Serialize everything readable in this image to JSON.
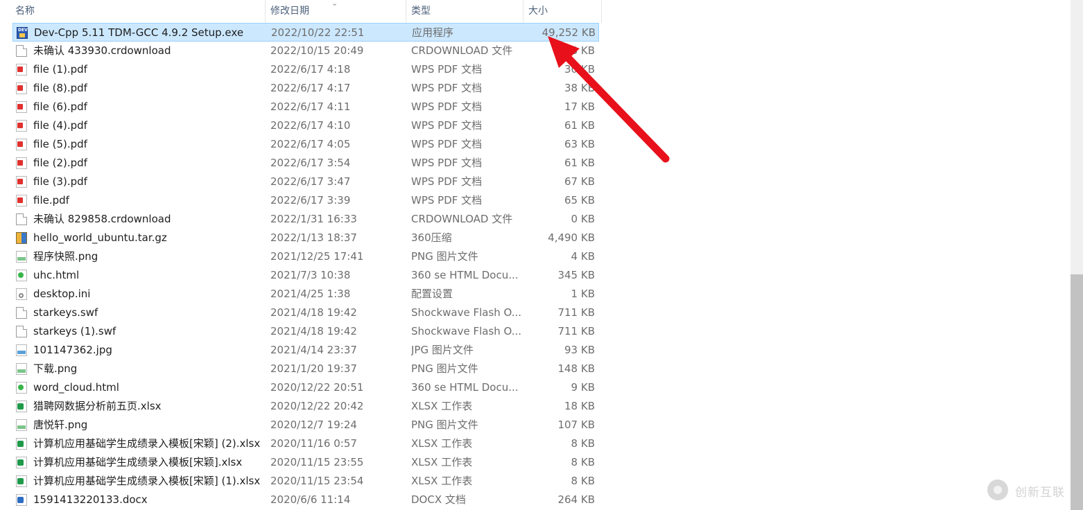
{
  "columns": {
    "name": "名称",
    "modified": "修改日期",
    "type": "类型",
    "size": "大小"
  },
  "files": [
    {
      "name": "Dev-Cpp 5.11 TDM-GCC 4.9.2 Setup.exe",
      "date": "2022/10/22 22:51",
      "type": "应用程序",
      "size": "49,252 KB",
      "icon": "exe-icon",
      "selected": true
    },
    {
      "name": "未确认 433930.crdownload",
      "date": "2022/10/15 20:49",
      "type": "CRDOWNLOAD 文件",
      "size": "3,18 KB",
      "icon": "file-icon"
    },
    {
      "name": "file (1).pdf",
      "date": "2022/6/17 4:18",
      "type": "WPS PDF 文档",
      "size": "30 KB",
      "icon": "pdf-icon"
    },
    {
      "name": "file (8).pdf",
      "date": "2022/6/17 4:17",
      "type": "WPS PDF 文档",
      "size": "38 KB",
      "icon": "pdf-icon"
    },
    {
      "name": "file (6).pdf",
      "date": "2022/6/17 4:11",
      "type": "WPS PDF 文档",
      "size": "17 KB",
      "icon": "pdf-icon"
    },
    {
      "name": "file (4).pdf",
      "date": "2022/6/17 4:10",
      "type": "WPS PDF 文档",
      "size": "61 KB",
      "icon": "pdf-icon"
    },
    {
      "name": "file (5).pdf",
      "date": "2022/6/17 4:05",
      "type": "WPS PDF 文档",
      "size": "63 KB",
      "icon": "pdf-icon"
    },
    {
      "name": "file (2).pdf",
      "date": "2022/6/17 3:54",
      "type": "WPS PDF 文档",
      "size": "61 KB",
      "icon": "pdf-icon"
    },
    {
      "name": "file (3).pdf",
      "date": "2022/6/17 3:47",
      "type": "WPS PDF 文档",
      "size": "67 KB",
      "icon": "pdf-icon"
    },
    {
      "name": "file.pdf",
      "date": "2022/6/17 3:39",
      "type": "WPS PDF 文档",
      "size": "65 KB",
      "icon": "pdf-icon"
    },
    {
      "name": "未确认 829858.crdownload",
      "date": "2022/1/31 16:33",
      "type": "CRDOWNLOAD 文件",
      "size": "0 KB",
      "icon": "file-icon"
    },
    {
      "name": "hello_world_ubuntu.tar.gz",
      "date": "2022/1/13 18:37",
      "type": "360压缩",
      "size": "4,490 KB",
      "icon": "archive-icon"
    },
    {
      "name": "程序快照.png",
      "date": "2021/12/25 17:41",
      "type": "PNG 图片文件",
      "size": "4 KB",
      "icon": "png-icon"
    },
    {
      "name": "uhc.html",
      "date": "2021/7/3 10:38",
      "type": "360 se HTML Docu...",
      "size": "345 KB",
      "icon": "html-icon"
    },
    {
      "name": "desktop.ini",
      "date": "2021/4/25 1:38",
      "type": "配置设置",
      "size": "1 KB",
      "icon": "ini-icon"
    },
    {
      "name": "starkeys.swf",
      "date": "2021/4/18 19:42",
      "type": "Shockwave Flash O...",
      "size": "711 KB",
      "icon": "file-icon"
    },
    {
      "name": "starkeys (1).swf",
      "date": "2021/4/18 19:42",
      "type": "Shockwave Flash O...",
      "size": "711 KB",
      "icon": "file-icon"
    },
    {
      "name": "101147362.jpg",
      "date": "2021/4/14 23:37",
      "type": "JPG 图片文件",
      "size": "93 KB",
      "icon": "jpg-icon"
    },
    {
      "name": "下载.png",
      "date": "2021/1/20 19:37",
      "type": "PNG 图片文件",
      "size": "148 KB",
      "icon": "png-icon"
    },
    {
      "name": "word_cloud.html",
      "date": "2020/12/22 20:51",
      "type": "360 se HTML Docu...",
      "size": "9 KB",
      "icon": "html-icon"
    },
    {
      "name": "猎聘网数据分析前五页.xlsx",
      "date": "2020/12/22 20:42",
      "type": "XLSX 工作表",
      "size": "18 KB",
      "icon": "xlsx-icon"
    },
    {
      "name": "唐悦轩.png",
      "date": "2020/12/7 19:24",
      "type": "PNG 图片文件",
      "size": "107 KB",
      "icon": "png-icon"
    },
    {
      "name": "计算机应用基础学生成绩录入模板[宋颖] (2).xlsx",
      "date": "2020/11/16 0:57",
      "type": "XLSX 工作表",
      "size": "8 KB",
      "icon": "xlsx-icon"
    },
    {
      "name": "计算机应用基础学生成绩录入模板[宋颖].xlsx",
      "date": "2020/11/15 23:55",
      "type": "XLSX 工作表",
      "size": "8 KB",
      "icon": "xlsx-icon"
    },
    {
      "name": "计算机应用基础学生成绩录入模板[宋颖] (1).xlsx",
      "date": "2020/11/15 23:54",
      "type": "XLSX 工作表",
      "size": "8 KB",
      "icon": "xlsx-icon"
    },
    {
      "name": "1591413220133.docx",
      "date": "2020/6/6 11:14",
      "type": "DOCX 文档",
      "size": "264 KB",
      "icon": "docx-icon"
    }
  ],
  "watermark": {
    "text": "创新互联"
  },
  "colors": {
    "selection": "#cce8ff",
    "arrow": "#e8101a",
    "header_text": "#4c607a"
  }
}
